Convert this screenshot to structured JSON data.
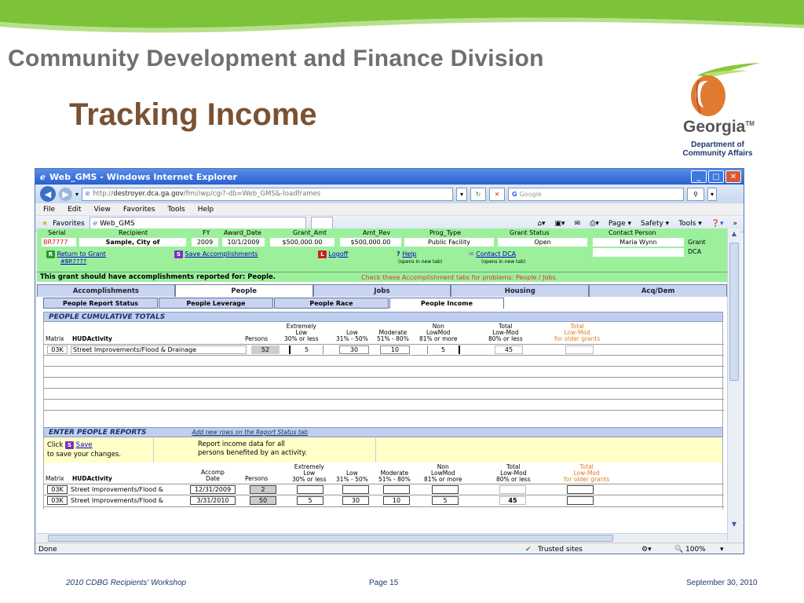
{
  "slide": {
    "division": "Community Development and Finance Division",
    "title": "Tracking Income",
    "logo": {
      "state": "Georgia",
      "dept_line1": "Department of",
      "dept_line2": "Community Affairs"
    },
    "footer": {
      "left": "2010 CDBG Recipients' Workshop",
      "center": "Page 15",
      "right": "September 30, 2010"
    },
    "colors": {
      "green": "#7cc33a",
      "brown": "#7a5232",
      "peach": "#e07a30"
    }
  },
  "browser": {
    "window_title": "Web_GMS - Windows Internet Explorer",
    "url_prefix": "http://",
    "url_domain": "destroyer.dca.ga.gov",
    "url_path": "/fmi/iwp/cgi?-db=Web_GMS&-loadframes",
    "search_placeholder": "Google",
    "menu": [
      "File",
      "Edit",
      "View",
      "Favorites",
      "Tools",
      "Help"
    ],
    "favorites_label": "Favorites",
    "tab_label": "Web_GMS",
    "toolbar": {
      "page": "Page ▾",
      "safety": "Safety ▾",
      "tools": "Tools ▾"
    },
    "status": {
      "done": "Done",
      "zone": "Trusted sites",
      "zoom": "100%"
    }
  },
  "grant": {
    "headers": {
      "serial": "Serial",
      "recipient": "Recipient",
      "fy": "FY",
      "award_date": "Award_Date",
      "grant_amt": "Grant_Amt",
      "amt_rev": "Amt_Rev",
      "prog_type": "Prog_Type",
      "status": "Grant Status",
      "contact": "Contact Person"
    },
    "values": {
      "serial": "BR7777",
      "recipient": "Sample, City of",
      "fy": "2009",
      "award_date": "10/1/2009",
      "grant_amt": "$500,000.00",
      "amt_rev": "$500,000.00",
      "prog_type": "Public Facility",
      "status": "Open",
      "contact": "Maria Wynn"
    },
    "side_label1": "Grant",
    "side_label2": "DCA",
    "return_link": "Return to Grant",
    "return_sub": "#BR7777",
    "save_link": "Save Accomplishments",
    "logoff": "Logoff",
    "help": "Help",
    "help_note": "(opens in new tab)",
    "contact_link": "Contact DCA",
    "contact_note": "(opens in new tab)",
    "badges": {
      "return": "R",
      "save": "S",
      "logoff": "L",
      "help": "?"
    }
  },
  "notice": {
    "text": "This grant should have accomplishments reported for: People.",
    "problems": "Check these Accomplishment tabs for problems: People / Jobs."
  },
  "tabs": [
    "Accomplishments",
    "People",
    "Jobs",
    "Housing",
    "Acq/Dem"
  ],
  "subtabs": [
    "People Report Status",
    "People Leverage",
    "People Race",
    "People Income"
  ],
  "cumulative": {
    "title": "PEOPLE CUMULATIVE TOTALS",
    "headers": {
      "matrix": "Matrix",
      "activity": "HUDActivity",
      "persons": "Persons",
      "ext_low": [
        "Extremely",
        "Low",
        "30% or less"
      ],
      "low": [
        "Low",
        "31% - 50%"
      ],
      "moderate": [
        "Moderate",
        "51% - 80%"
      ],
      "non_lowmod": [
        "Non",
        "LowMod",
        "81% or more"
      ],
      "total_lowmod": [
        "Total",
        "Low-Mod",
        "80% or less"
      ],
      "older": [
        "Total",
        "Low-Mod",
        "for older grants"
      ]
    },
    "row": {
      "matrix": "03K",
      "activity": "Street Improvements/Flood & Drainage",
      "persons": "52",
      "ext_low": "5",
      "low": "30",
      "moderate": "10",
      "non_lowmod": "5",
      "total": "45"
    }
  },
  "enter": {
    "title": "ENTER PEOPLE REPORTS",
    "add_rows_link": "Add new rows on the Report Status tab",
    "click_text": "Click",
    "save_link": "Save",
    "save_text": "to save your changes.",
    "report_text1": "Report income data for all",
    "report_text2": "persons benefited by an activity.",
    "headers": {
      "matrix": "Matrix",
      "activity": "HUDActivity",
      "accomp": [
        "Accomp",
        "Date"
      ],
      "persons": "Persons",
      "ext_low": [
        "Extremely",
        "Low",
        "30% or less"
      ],
      "low": [
        "Low",
        "31% - 50%"
      ],
      "moderate": [
        "Moderate",
        "51% - 80%"
      ],
      "non_lowmod": [
        "Non",
        "LowMod",
        "81% or more"
      ],
      "total_lowmod": [
        "Total",
        "Low-Mod",
        "80% or less"
      ],
      "older": [
        "Total",
        "Low-Mod",
        "for older grants"
      ]
    },
    "rows": [
      {
        "matrix": "03K",
        "activity": "Street Improvements/Flood &",
        "date": "12/31/2009",
        "persons": "2",
        "ext_low": "",
        "low": "",
        "moderate": "",
        "non_lowmod": "",
        "total": ""
      },
      {
        "matrix": "03K",
        "activity": "Street Improvements/Flood &",
        "date": "3/31/2010",
        "persons": "50",
        "ext_low": "5",
        "low": "30",
        "moderate": "10",
        "non_lowmod": "5",
        "total": "45"
      }
    ]
  }
}
